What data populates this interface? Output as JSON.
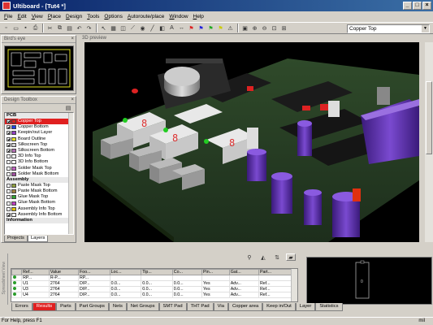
{
  "window": {
    "title": "Ultiboard - [Tut4 *]"
  },
  "menu": [
    "File",
    "Edit",
    "View",
    "Place",
    "Design",
    "Tools",
    "Options",
    "Autoroute/place",
    "Window",
    "Help"
  ],
  "toolbar": {
    "layer_select_value": "Copper Top"
  },
  "birdseye": {
    "title": "Bird's eye"
  },
  "toolbox": {
    "title": "Design Toolbox",
    "groups": [
      {
        "label": "PCB",
        "layers": [
          {
            "name": "Copper Top",
            "color": "#e02020",
            "checked": true,
            "selected": true
          },
          {
            "name": "Copper Bottom",
            "color": "#2040e0",
            "checked": true
          },
          {
            "name": "Keepin/out Layer",
            "color": "#9040c0",
            "checked": true
          },
          {
            "name": "Board Outline",
            "color": "#e0e020",
            "checked": true
          },
          {
            "name": "Silkscreen Top",
            "color": "#d0d0d0",
            "checked": true
          },
          {
            "name": "Silkscreen Bottom",
            "color": "#b070b0",
            "checked": true
          },
          {
            "name": "3D Info Top",
            "color": "#ffffff",
            "checked": false
          },
          {
            "name": "3D Info Bottom",
            "color": "#ffffff",
            "checked": false
          },
          {
            "name": "Solder Mask Top",
            "color": "#c060c0",
            "checked": false
          },
          {
            "name": "Solder Mask Bottom",
            "color": "#a050a0",
            "checked": false
          }
        ]
      },
      {
        "label": "Assembly",
        "layers": [
          {
            "name": "Paste Mask Top",
            "color": "#90a040",
            "checked": false
          },
          {
            "name": "Paste Mask Bottom",
            "color": "#a08040",
            "checked": false
          },
          {
            "name": "Glue Mask Top",
            "color": "#30a030",
            "checked": false
          },
          {
            "name": "Glue Mask Bottom",
            "color": "#c040c0",
            "checked": false
          },
          {
            "name": "Assembly Info Top",
            "color": "#e0c000",
            "checked": false
          },
          {
            "name": "Assembly Info Bottom",
            "color": "#f0f0f0",
            "checked": true
          }
        ]
      },
      {
        "label": "Information",
        "layers": []
      }
    ],
    "tabs": [
      "Projects",
      "Layers"
    ]
  },
  "view3d": {
    "title": "3D preview"
  },
  "spreadsheet": {
    "side_label": "Spreadsheet View",
    "columns": [
      "",
      "Ref...",
      "Value",
      "Foo...",
      "Loc...",
      "Tip...",
      "Co...",
      "Pin...",
      "Gat...",
      "Part..."
    ],
    "rows": [
      [
        "",
        "RP...",
        "R-P...",
        "RP...",
        "",
        "",
        "",
        "",
        "",
        ""
      ],
      [
        "",
        "U1",
        "2764",
        "DIP...",
        "0.0...",
        "0.0...",
        "0.0...",
        "Yes",
        "Adv...",
        "Ref..."
      ],
      [
        "",
        "U3",
        "2764",
        "DIP...",
        "0.0...",
        "0.0...",
        "0.0...",
        "Yes",
        "Adv...",
        "Ref..."
      ],
      [
        "",
        "U4",
        "2764",
        "DIP...",
        "0.0...",
        "0.0...",
        "0.0...",
        "Yes",
        "Adv...",
        "Ref..."
      ]
    ],
    "tabs": [
      "Errors",
      "Results",
      "Parts",
      "Part Groups",
      "Nets",
      "Net Groups",
      "SMT Pad",
      "THT Pad",
      "Via",
      "Copper area",
      "Keep in/Out",
      "Layer",
      "Statistics"
    ],
    "active_tab": "Results"
  },
  "status": {
    "left": "For Help, press F1",
    "right": "mil"
  }
}
